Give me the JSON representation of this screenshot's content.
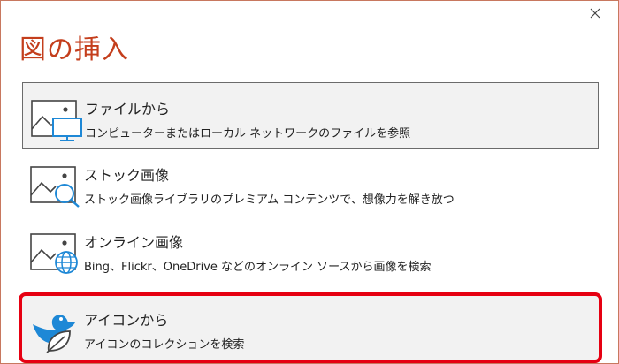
{
  "dialog": {
    "title": "図の挿入"
  },
  "options": [
    {
      "title": "ファイルから",
      "desc": "コンピューターまたはローカル ネットワークのファイルを参照"
    },
    {
      "title": "ストック画像",
      "desc": "ストック画像ライブラリのプレミアム コンテンツで、想像力を解き放つ"
    },
    {
      "title": "オンライン画像",
      "desc": "Bing、Flickr、OneDrive などのオンライン ソースから画像を検索"
    },
    {
      "title": "アイコンから",
      "desc": "アイコンのコレクションを検索"
    }
  ],
  "colors": {
    "title": "#c43e1c",
    "accent_blue": "#1e88d6",
    "highlight": "#e60012"
  },
  "icons": [
    "close-icon",
    "computer-icon",
    "magnifier-icon",
    "globe-icon",
    "bird-leaf-icon"
  ]
}
